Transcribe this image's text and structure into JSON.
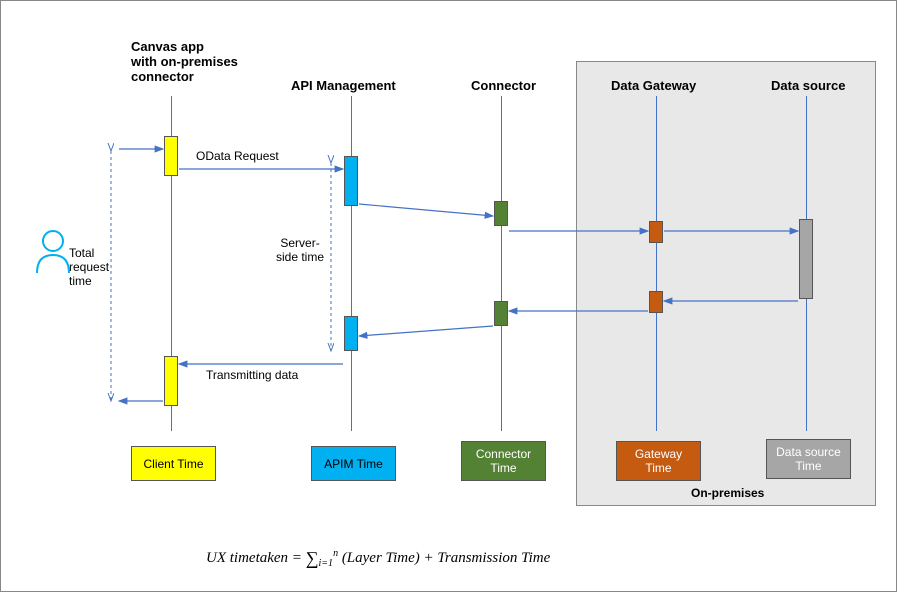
{
  "headers": {
    "canvas": "Canvas app\nwith on-premises\nconnector",
    "apim": "API Management",
    "connector": "Connector",
    "gateway": "Data Gateway",
    "datasource": "Data source"
  },
  "labels": {
    "odata": "OData Request",
    "server_side": "Server-\nside time",
    "total_request": "Total\nrequest\ntime",
    "transmitting": "Transmitting data",
    "onpremises": "On-premises"
  },
  "legend": {
    "client": "Client Time",
    "apim": "APIM Time",
    "connector": "Connector\nTime",
    "gateway": "Gateway\nTime",
    "datasource": "Data source\nTime"
  },
  "formula": {
    "left": "UX timetaken  =  ",
    "summ_sub": "i=1",
    "summ_sup": "n",
    "right": "(Layer Time) + Transmission Time"
  }
}
